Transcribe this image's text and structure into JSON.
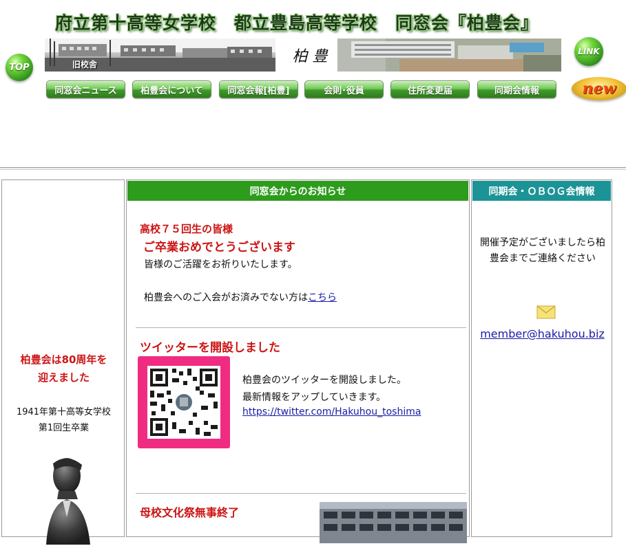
{
  "header": {
    "site_title": "府立第十高等女学校　都立豊島高等学校　同窓会『柏豊会』",
    "top_label": "TOP",
    "link_label": "LINK",
    "new_label": "new",
    "old_building_caption": "旧校舎",
    "calligraphy": "柏 豊"
  },
  "nav": {
    "items": [
      {
        "label": "同窓会ニュース"
      },
      {
        "label": "柏豊会について"
      },
      {
        "label": "同窓会報[柏豊]"
      },
      {
        "label": "会則･役員"
      },
      {
        "label": "住所変更届"
      },
      {
        "label": "同期会情報"
      }
    ]
  },
  "left_column": {
    "anniversary_line1": "柏豊会は80周年を",
    "anniversary_line2": "迎えました",
    "grad_line1": "1941年第十高等女学校",
    "grad_line2": "第1回生卒業"
  },
  "center_column": {
    "header": "同窓会からのお知らせ",
    "notice1": {
      "title": "高校７５回生の皆様",
      "subtitle": "ご卒業おめでとうございます",
      "line1": "皆様のご活躍をお祈りいたします。",
      "join_text": "柏豊会へのご入会がお済みでない方は",
      "join_link": "こちら"
    },
    "notice2": {
      "title": "ツイッターを開設しました",
      "line1": "柏豊会のツイッターを開設しました。",
      "line2": "最新情報をアップしていきます。",
      "url": "https://twitter.com/Hakuhou_toshima"
    },
    "notice3": {
      "title": "母校文化祭無事終了"
    }
  },
  "right_column": {
    "header": "同期会・ＯＢＯＧ会情報",
    "message": "開催予定がございましたら柏豊会までご連絡ください",
    "email": "member@hakuhou.biz"
  },
  "colors": {
    "nav_green": "#3f9a2a",
    "center_header": "#2d9c1c",
    "right_header": "#1c9396",
    "notice_red": "#cc1414",
    "link_blue": "#1a1aa6",
    "qr_background": "#f02c82"
  },
  "icons": {
    "envelope": "envelope-icon",
    "qr": "qr-code-icon"
  }
}
